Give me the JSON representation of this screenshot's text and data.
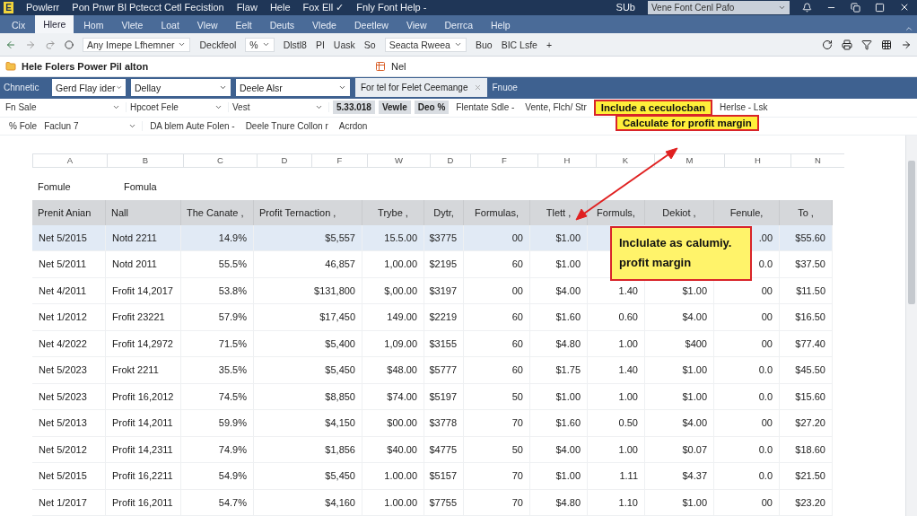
{
  "title_bar": {
    "app_icon": "E",
    "menu": [
      "Powlerr",
      "Pon Pnwr Bl Pctecct Cetl Fecistion",
      "Flaw",
      "Hele",
      "Fox Ell ✓",
      "Fnly Font Help -"
    ],
    "right_label": "SUb",
    "search": {
      "value": "Vene Font Cenl Pafo"
    }
  },
  "ribbon_tabs": [
    {
      "label": "Cix",
      "selected": false
    },
    {
      "label": "Hlere",
      "selected": true
    },
    {
      "label": "Hom",
      "selected": false
    },
    {
      "label": "Vlete",
      "selected": false
    },
    {
      "label": "Loat",
      "selected": false
    },
    {
      "label": "Vlew",
      "selected": false
    },
    {
      "label": "Eelt",
      "selected": false
    },
    {
      "label": "Deuts",
      "selected": false
    },
    {
      "label": "Vlede",
      "selected": false
    },
    {
      "label": "Deetlew",
      "selected": false
    },
    {
      "label": "View",
      "selected": false
    },
    {
      "label": "Derrca",
      "selected": false
    },
    {
      "label": "Help",
      "selected": false
    }
  ],
  "toolbar": [
    {
      "kind": "dropdown",
      "label": "Any Imepe Lfhemner"
    },
    {
      "kind": "text",
      "label": "Deckfeol"
    },
    {
      "kind": "dropdown",
      "label": "%"
    },
    {
      "kind": "text",
      "label": "Dlstl8"
    },
    {
      "kind": "text",
      "label": "PI"
    },
    {
      "kind": "text",
      "label": "Uask"
    },
    {
      "kind": "text",
      "label": "So"
    },
    {
      "kind": "dropdown",
      "label": "Seacta Rweea"
    },
    {
      "kind": "text",
      "label": "Buo"
    },
    {
      "kind": "text",
      "label": "BIC Lsfe"
    },
    {
      "kind": "text",
      "label": "+"
    }
  ],
  "name_bar": {
    "name": "Hele Folers Power Pil alton",
    "cell": "Nel"
  },
  "filter_bar": {
    "label": "Chnnetic",
    "dropdowns": [
      "Gerd Flay ider",
      "Dellay",
      "Deele Alsr"
    ],
    "tab": {
      "label": "For tel for Felet Ceemange"
    },
    "link": "Fnuoe"
  },
  "option_rows": [
    [
      {
        "kind": "dropdown",
        "label": "Fn Sale"
      },
      {
        "kind": "dropdown",
        "label": "Hpcoet Fele"
      },
      {
        "kind": "dropdown",
        "label": "Vest"
      },
      {
        "kind": "group",
        "label": "5.33.018"
      },
      {
        "kind": "group",
        "label": "Vewle"
      },
      {
        "kind": "group",
        "label": "Deo %"
      },
      {
        "kind": "text",
        "label": "Flentate Sdle -"
      },
      {
        "kind": "text",
        "label": "Vente, Flch/ Str"
      },
      {
        "kind": "callout",
        "label": "Include a ceculocban"
      },
      {
        "kind": "text",
        "label": "Herlse - Lsk"
      }
    ],
    [
      {
        "kind": "text",
        "label": "% Fole"
      },
      {
        "kind": "dropdown",
        "label": "Faclun   7"
      },
      {
        "kind": "text",
        "label": "DA blem Aute Folen -"
      },
      {
        "kind": "text",
        "label": "Deele Tnure Collon r"
      },
      {
        "kind": "text",
        "label": "Acrdon"
      }
    ]
  ],
  "callouts": [
    {
      "text": "Calculate for profit margin"
    },
    {
      "text": "Inclulate as calumiy. profit margin"
    }
  ],
  "column_letters": [
    "A",
    "B",
    "C",
    "D",
    "F",
    "W",
    "D",
    "F",
    "H",
    "K",
    "M",
    "H",
    "N"
  ],
  "formula_labels": [
    "Fomule",
    "Fomula"
  ],
  "table": {
    "columns": [
      "Prenit Anian",
      "Nall",
      "The Canate ,",
      "Profit Ternaction ,",
      "Trybe ,",
      "Dytr,",
      "Formulas,",
      "Tlett ,",
      "Formuls,",
      "Dekiot ,",
      "Fenule,",
      "To ,"
    ],
    "rows": [
      {
        "selected": true,
        "cells": [
          "Net 5/2015",
          "Notd 2211",
          "14.9%",
          "$5,557",
          "15.5.00",
          "$3775",
          "00",
          "$1.00",
          null,
          null,
          ".00",
          "$55.60"
        ]
      },
      {
        "selected": false,
        "cells": [
          "Net 5/2011",
          "Notd 2011",
          "55.5%",
          "46,857",
          "1,00.00",
          "$2195",
          "60",
          "$1.00",
          null,
          null,
          "0.0",
          "$37.50"
        ]
      },
      {
        "selected": false,
        "cells": [
          "Net 4/2011",
          "Frofit 14,2017",
          "53.8%",
          "$131,800",
          "$,00.00",
          "$3197",
          "00",
          "$4.00",
          "1.40",
          "$1.00",
          "00",
          "$11.50"
        ]
      },
      {
        "selected": false,
        "cells": [
          "Net 1/2012",
          "Frofit 23221",
          "57.9%",
          "$17,450",
          "149.00",
          "$2219",
          "60",
          "$1.60",
          "0.60",
          "$4.00",
          "00",
          "$16.50"
        ]
      },
      {
        "selected": false,
        "cells": [
          "Net 4/2022",
          "Frofit 14,2972",
          "71.5%",
          "$5,400",
          "1,09.00",
          "$3155",
          "60",
          "$4.80",
          "1.00",
          "$400",
          "00",
          "$77.40"
        ]
      },
      {
        "selected": false,
        "cells": [
          "Net 5/2023",
          "Frokt 2211",
          "35.5%",
          "$5,450",
          "$48.00",
          "$5777",
          "60",
          "$1.75",
          "1.40",
          "$1.00",
          "0.0",
          "$45.50"
        ]
      },
      {
        "selected": false,
        "cells": [
          "Net 5/2023",
          "Profit 16,2012",
          "74.5%",
          "$8,850",
          "$74.00",
          "$5197",
          "50",
          "$1.00",
          "1.00",
          "$1.00",
          "0.0",
          "$15.60"
        ]
      },
      {
        "selected": false,
        "cells": [
          "Net 5/2013",
          "Profit 14,2011",
          "59.9%",
          "$4,150",
          "$00.00",
          "$3778",
          "70",
          "$1.60",
          "0.50",
          "$4.00",
          "00",
          "$27.20"
        ]
      },
      {
        "selected": false,
        "cells": [
          "Net 5/2012",
          "Profit 14,2311",
          "74.9%",
          "$1,856",
          "$40.00",
          "$4775",
          "50",
          "$4.00",
          "1.00",
          "$0.07",
          "0.0",
          "$18.60"
        ]
      },
      {
        "selected": false,
        "cells": [
          "Net 5/2015",
          "Profit 16,2211",
          "54.9%",
          "$5,450",
          "1.00.00",
          "$5157",
          "70",
          "$1.00",
          "1.11",
          "$4.37",
          "0.0",
          "$21.50"
        ]
      },
      {
        "selected": false,
        "cells": [
          "Net 1/2017",
          "Profit 16,2011",
          "54.7%",
          "$4,160",
          "1.00.00",
          "$7755",
          "70",
          "$4.80",
          "1.10",
          "$1.00",
          "00",
          "$23.20"
        ]
      }
    ]
  }
}
